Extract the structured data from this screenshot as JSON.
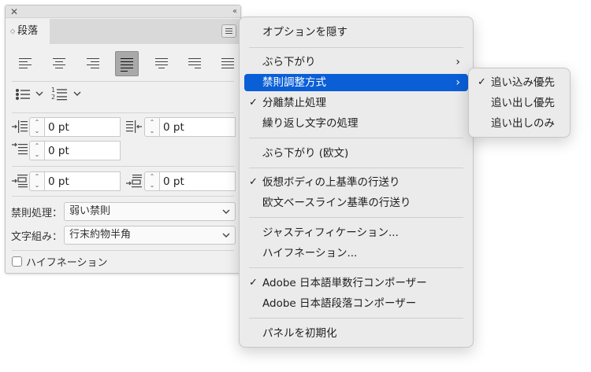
{
  "panel": {
    "tab_label": "段落",
    "indent_left": "0 pt",
    "indent_right": "0 pt",
    "indent_first_line": "0 pt",
    "space_before": "0 pt",
    "space_after": "0 pt",
    "kinsoku_label": "禁則処理：",
    "kinsoku_value": "弱い禁則",
    "mojikumi_label": "文字組み：",
    "mojikumi_value": "行末約物半角",
    "hyphenation_label": "ハイフネーション",
    "hyphenation_checked": false
  },
  "menu": {
    "items": [
      {
        "label": "オプションを隠す"
      },
      {
        "label": "ぶら下がり"
      },
      {
        "label": "禁則調整方式"
      },
      {
        "label": "分離禁止処理"
      },
      {
        "label": "繰り返し文字の処理"
      },
      {
        "label": "ぶら下がり (欧文)"
      },
      {
        "label": "仮想ボディの上基準の行送り"
      },
      {
        "label": "欧文ベースライン基準の行送り"
      },
      {
        "label": "ジャスティフィケーション..."
      },
      {
        "label": "ハイフネーション..."
      },
      {
        "label": "Adobe 日本語単数行コンポーザー"
      },
      {
        "label": "Adobe 日本語段落コンポーザー"
      },
      {
        "label": "パネルを初期化"
      }
    ]
  },
  "submenu": {
    "items": [
      {
        "label": "追い込み優先"
      },
      {
        "label": "追い出し優先"
      },
      {
        "label": "追い出しのみ"
      }
    ]
  },
  "icons": {
    "check": "✓",
    "arrow": "›",
    "close": "✕",
    "collapse": "‹‹",
    "chevron": "⌄"
  },
  "colors": {
    "highlight": "#0a5fd6"
  }
}
